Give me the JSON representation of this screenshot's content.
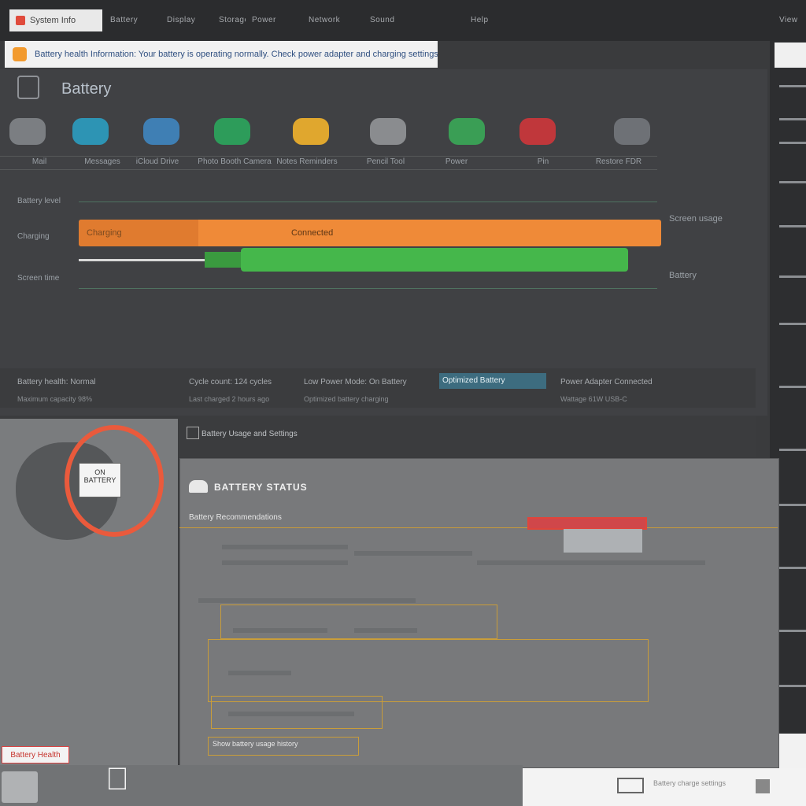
{
  "topbar": {
    "app_chip": "System Info",
    "menus": [
      "Battery",
      "Display",
      "Storage",
      "Power",
      "Network",
      "Sound",
      "Help"
    ],
    "right": "View"
  },
  "notice": {
    "text": "Battery health Information: Your battery is operating normally. Check power adapter and charging settings for details."
  },
  "header": {
    "title": "Battery"
  },
  "apps": [
    {
      "label": "Mail",
      "color": "#7b7e82"
    },
    {
      "label": "Messages",
      "color": "#2d94b4"
    },
    {
      "label": "iCloud Drive",
      "color": "#3f7fb4"
    },
    {
      "label": "Photo Booth Camera",
      "color": "#2d9c5a"
    },
    {
      "label": "Notes Reminders",
      "color": "#e0a72e"
    },
    {
      "label": "Pencil Tool",
      "color": "#8a8c8f"
    },
    {
      "label": "Power",
      "color": "#3a9e55"
    },
    {
      "label": "Pin",
      "color": "#c0373b"
    },
    {
      "label": "Restore FDR",
      "color": "#6e7176"
    }
  ],
  "chart": {
    "row1_label": "Battery level",
    "row2_label": "Charging",
    "row3_label": "Screen time",
    "orange_a": "Charging",
    "orange_b": "Connected",
    "right_a": "Screen usage",
    "right_b": "Battery"
  },
  "stats": [
    {
      "main": "Battery health: Normal",
      "sub": "Maximum capacity 98%"
    },
    {
      "main": "Cycle count: 124 cycles",
      "sub": "Last charged 2 hours ago"
    },
    {
      "main": "Low Power Mode: On Battery",
      "sub": "Optimized battery charging"
    },
    {
      "main": "Power Adapter Connected",
      "sub": "Wattage 61W USB-C"
    }
  ],
  "highlight_stat": "Optimized Battery",
  "section": {
    "sub_title": "Battery Usage and Settings",
    "dialog_title": "BATTERY STATUS",
    "dialog_sub": "Battery Recommendations",
    "bottom_link": "Show battery usage history"
  },
  "device_card": {
    "line1": "ON",
    "line2": "BATTERY"
  },
  "bottom_tag": "Battery Health",
  "bottom_right_text": "Battery charge settings"
}
